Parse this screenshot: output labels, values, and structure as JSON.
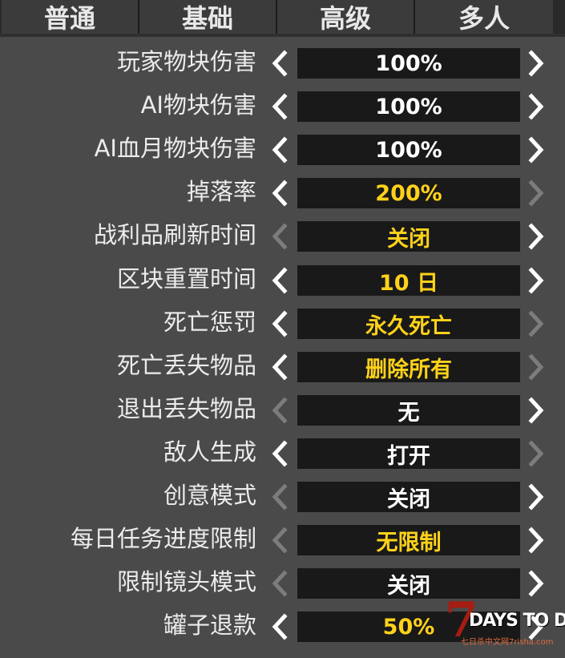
{
  "tabs": [
    {
      "label": "普通",
      "active": false
    },
    {
      "label": "基础",
      "active": false
    },
    {
      "label": "高级",
      "active": true
    },
    {
      "label": "多人",
      "active": false
    }
  ],
  "settings": [
    {
      "label": "玩家物块伤害",
      "value": "100%",
      "changed": false,
      "left_enabled": true,
      "right_enabled": true
    },
    {
      "label": "AI物块伤害",
      "value": "100%",
      "changed": false,
      "left_enabled": true,
      "right_enabled": true
    },
    {
      "label": "AI血月物块伤害",
      "value": "100%",
      "changed": false,
      "left_enabled": true,
      "right_enabled": true
    },
    {
      "label": "掉落率",
      "value": "200%",
      "changed": true,
      "left_enabled": true,
      "right_enabled": false
    },
    {
      "label": "战利品刷新时间",
      "value": "关闭",
      "changed": true,
      "left_enabled": false,
      "right_enabled": true
    },
    {
      "label": "区块重置时间",
      "value": "10 日",
      "changed": true,
      "left_enabled": true,
      "right_enabled": true
    },
    {
      "label": "死亡惩罚",
      "value": "永久死亡",
      "changed": true,
      "left_enabled": true,
      "right_enabled": false
    },
    {
      "label": "死亡丢失物品",
      "value": "删除所有",
      "changed": true,
      "left_enabled": true,
      "right_enabled": false
    },
    {
      "label": "退出丢失物品",
      "value": "无",
      "changed": false,
      "left_enabled": false,
      "right_enabled": true
    },
    {
      "label": "敌人生成",
      "value": "打开",
      "changed": false,
      "left_enabled": true,
      "right_enabled": false
    },
    {
      "label": "创意模式",
      "value": "关闭",
      "changed": false,
      "left_enabled": false,
      "right_enabled": true
    },
    {
      "label": "每日任务进度限制",
      "value": "无限制",
      "changed": true,
      "left_enabled": false,
      "right_enabled": true
    },
    {
      "label": "限制镜头模式",
      "value": "关闭",
      "changed": false,
      "left_enabled": false,
      "right_enabled": true
    },
    {
      "label": "罐子退款",
      "value": "50%",
      "changed": true,
      "left_enabled": true,
      "right_enabled": true
    }
  ],
  "watermark": {
    "numeral": "7",
    "title": "DAYS TO DIE",
    "subtitle": "七日杀中文网7risha.com"
  },
  "colors": {
    "background": "#4a4a4a",
    "value_box": "#191919",
    "changed_value": "#ffd21a",
    "default_value": "#ffffff",
    "disabled_arrow": "#7c7c7c"
  }
}
